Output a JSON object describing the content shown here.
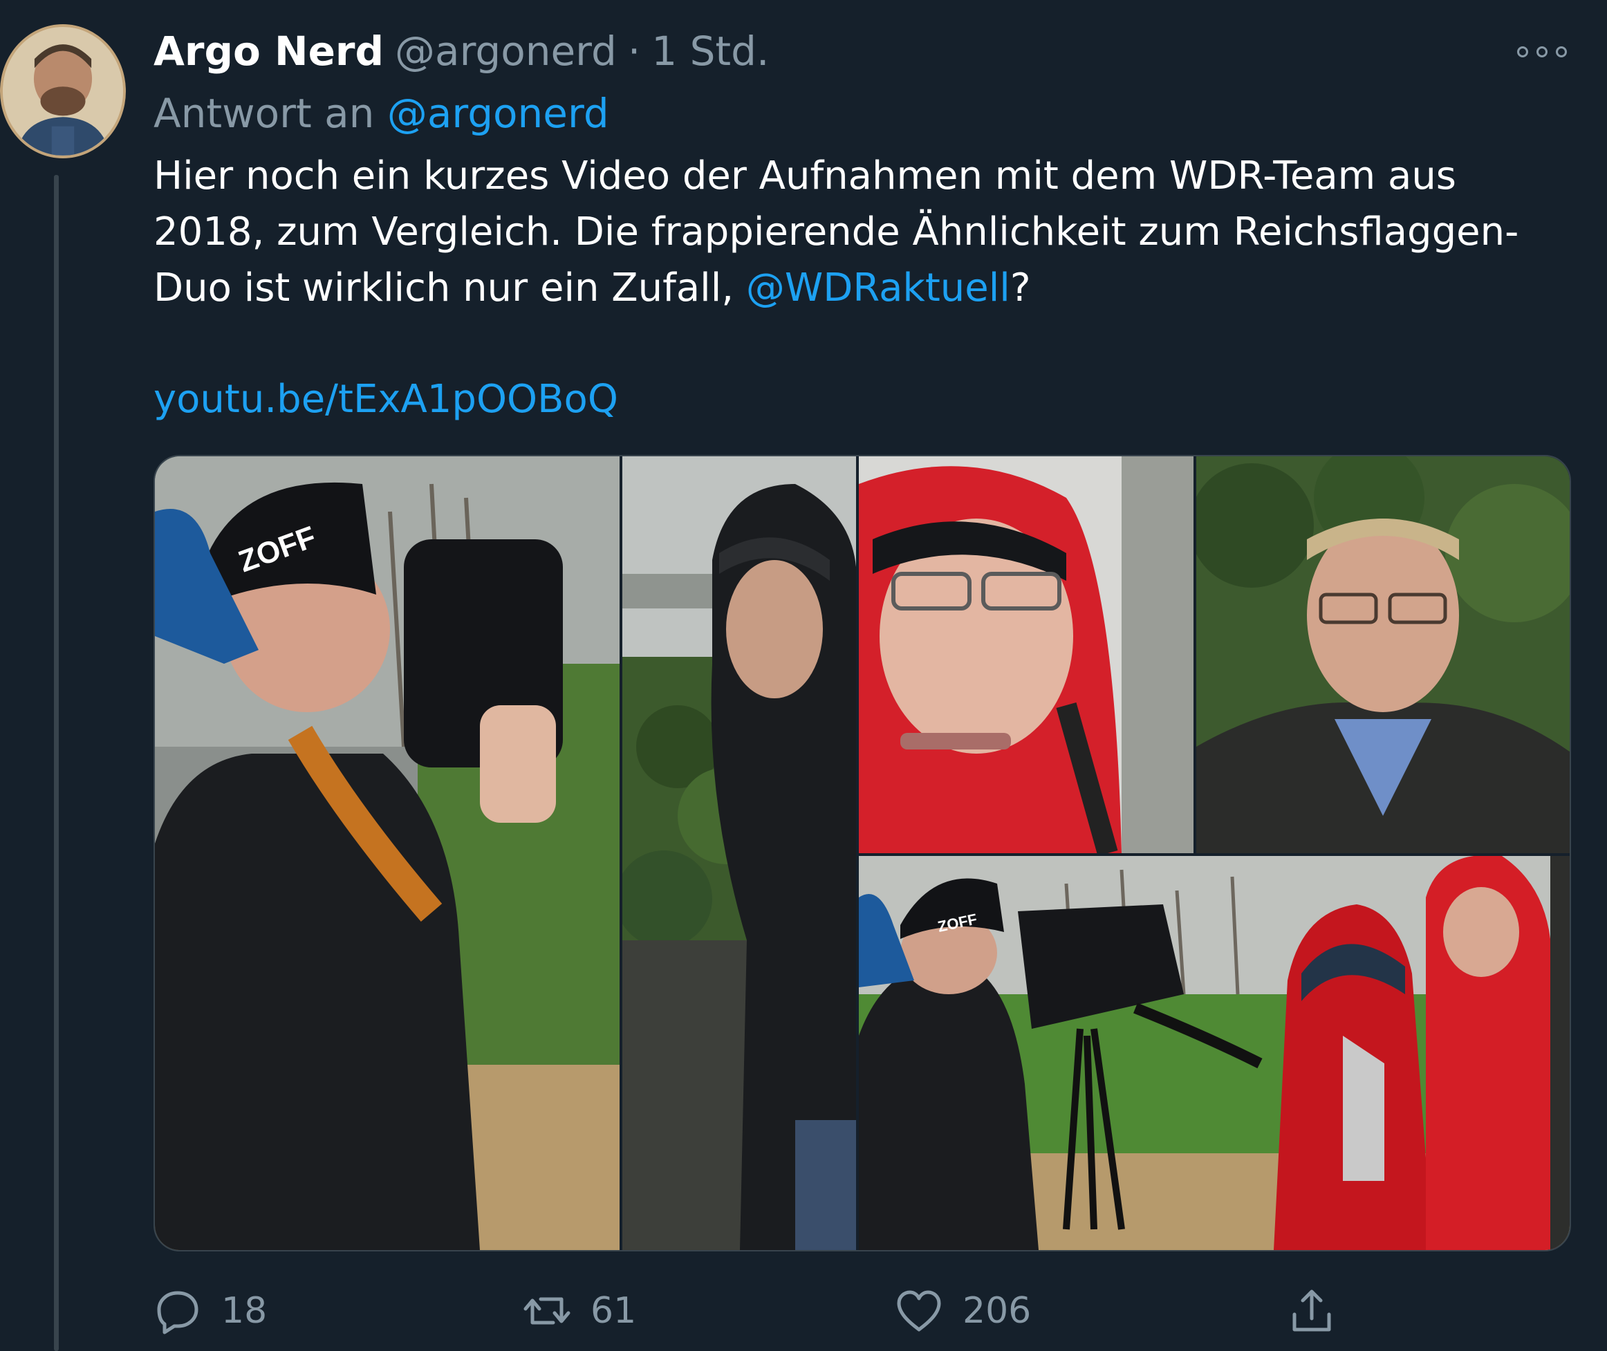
{
  "tweet": {
    "author_name": "Argo Nerd",
    "author_handle": "@argonerd",
    "separator": "·",
    "timestamp": "1 Std.",
    "reply_prefix": "Antwort an",
    "reply_handle": "@argonerd",
    "text_line1": "Hier noch ein kurzes Video der Aufnahmen mit dem WDR-Team aus",
    "text_line2": "2018, zum Vergleich. Die frappierende Ähnlichkeit zum Reichsflaggen-",
    "text_line3_start": "Duo ist wirklich nur ein Zufall, ",
    "text_mention": "@WDRaktuell",
    "text_line3_end": "?",
    "url": "youtu.be/tExA1pOOBoQ",
    "photo1_badge": "ZOFF",
    "photo5_badge": "ZOFF"
  },
  "actions": {
    "reply_count": "18",
    "retweet_count": "61",
    "like_count": "206"
  },
  "icons": {
    "more": "more-options-icon",
    "reply": "reply-icon",
    "retweet": "retweet-icon",
    "like": "heart-icon",
    "share": "share-icon"
  },
  "colors": {
    "background": "#15202b",
    "text": "#ffffff",
    "secondary": "#8899a6",
    "link": "#1da1f2",
    "divider": "#38444d"
  }
}
